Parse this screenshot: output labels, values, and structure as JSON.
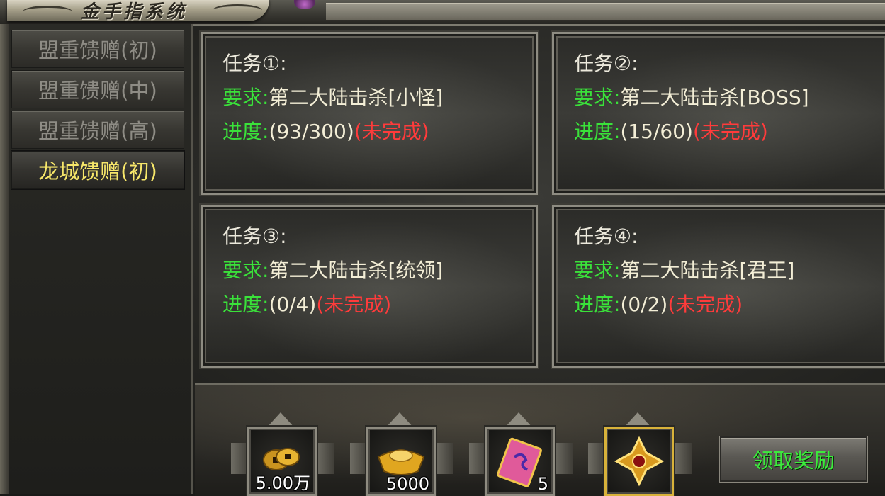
{
  "window": {
    "title": "金手指系统"
  },
  "sidebar": {
    "items": [
      {
        "label": "盟重馈赠(初)",
        "active": false
      },
      {
        "label": "盟重馈赠(中)",
        "active": false
      },
      {
        "label": "盟重馈赠(高)",
        "active": false
      },
      {
        "label": "龙城馈赠(初)",
        "active": true
      }
    ]
  },
  "tasks": [
    {
      "title": "任务①:",
      "req_label": "要求:",
      "req_text": "第二大陆击杀[小怪]",
      "prog_label": "进度:",
      "prog_value": "(93/300)",
      "status": "(未完成)"
    },
    {
      "title": "任务②:",
      "req_label": "要求:",
      "req_text": "第二大陆击杀[BOSS]",
      "prog_label": "进度:",
      "prog_value": "(15/60)",
      "status": "(未完成)"
    },
    {
      "title": "任务③:",
      "req_label": "要求:",
      "req_text": "第二大陆击杀[统领]",
      "prog_label": "进度:",
      "prog_value": "(0/4)",
      "status": "(未完成)"
    },
    {
      "title": "任务④:",
      "req_label": "要求:",
      "req_text": "第二大陆击杀[君王]",
      "prog_label": "进度:",
      "prog_value": "(0/2)",
      "status": "(未完成)"
    }
  ],
  "rewards": [
    {
      "icon": "gold-coins-icon",
      "qty": "5.00万"
    },
    {
      "icon": "gold-ingot-icon",
      "qty": "5000"
    },
    {
      "icon": "scroll-ticket-icon",
      "qty": "5"
    },
    {
      "icon": "golden-emblem-icon",
      "qty": ""
    }
  ],
  "claim_button": {
    "label": "领取奖励"
  },
  "colors": {
    "active_tab": "#f7e76a",
    "requirement_label": "#3ae23a",
    "incomplete": "#ff3b3b",
    "claim_text": "#3cea3c"
  }
}
